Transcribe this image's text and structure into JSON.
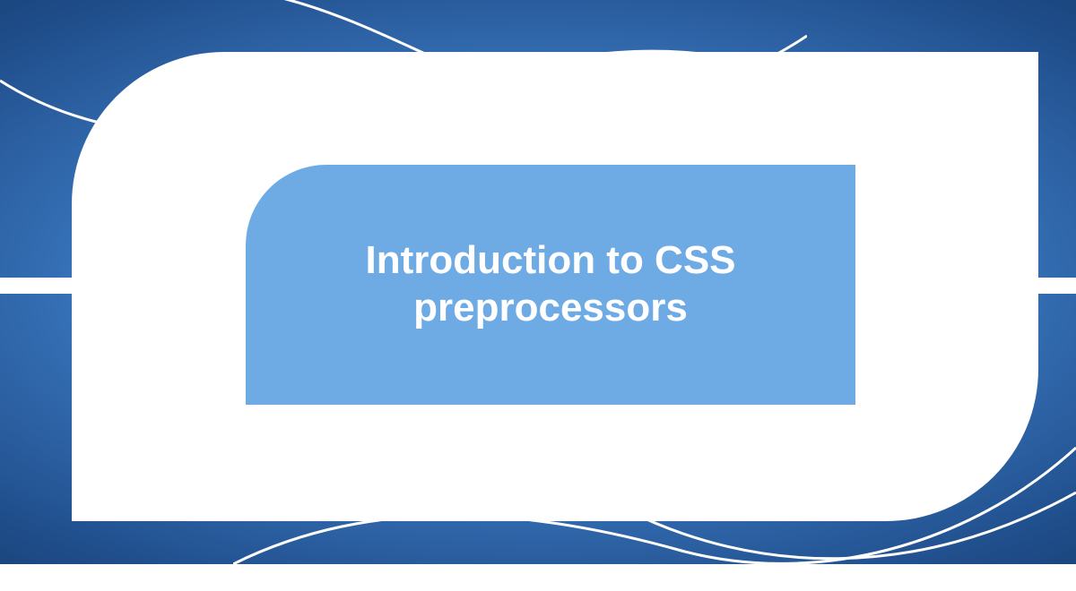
{
  "title": "Introduction to CSS preprocessors",
  "colors": {
    "frame": "#ffffff",
    "panel": "#6eaae3",
    "text": "#ffffff"
  }
}
